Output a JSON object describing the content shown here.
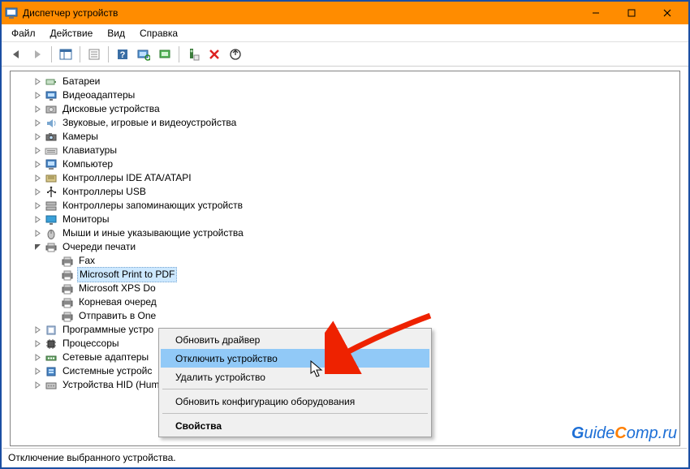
{
  "window": {
    "title": "Диспетчер устройств"
  },
  "menubar": {
    "file": "Файл",
    "action": "Действие",
    "view": "Вид",
    "help": "Справка"
  },
  "tree": {
    "items": [
      {
        "label": "Батареи"
      },
      {
        "label": "Видеоадаптеры"
      },
      {
        "label": "Дисковые устройства"
      },
      {
        "label": "Звуковые, игровые и видеоустройства"
      },
      {
        "label": "Камеры"
      },
      {
        "label": "Клавиатуры"
      },
      {
        "label": "Компьютер"
      },
      {
        "label": "Контроллеры IDE ATA/ATAPI"
      },
      {
        "label": "Контроллеры USB"
      },
      {
        "label": "Контроллеры запоминающих устройств"
      },
      {
        "label": "Мониторы"
      },
      {
        "label": "Мыши и иные указывающие устройства"
      },
      {
        "label": "Очереди печати"
      }
    ],
    "printers": [
      {
        "label": "Fax"
      },
      {
        "label": "Microsoft Print to PDF"
      },
      {
        "label": "Microsoft XPS Do"
      },
      {
        "label": "Корневая очеред"
      },
      {
        "label": "Отправить в One"
      }
    ],
    "after": [
      {
        "label": "Программные устро"
      },
      {
        "label": "Процессоры"
      },
      {
        "label": "Сетевые адаптеры"
      },
      {
        "label": "Системные устройс"
      },
      {
        "label": "Устройства HID (Human Interface Devices)"
      }
    ]
  },
  "contextmenu": {
    "update_driver": "Обновить драйвер",
    "disable_device": "Отключить устройство",
    "delete_device": "Удалить устройство",
    "refresh_config": "Обновить конфигурацию оборудования",
    "properties": "Свойства"
  },
  "statusbar": {
    "text": "Отключение выбранного устройства."
  },
  "watermark": {
    "text": "GuideComp.ru"
  }
}
